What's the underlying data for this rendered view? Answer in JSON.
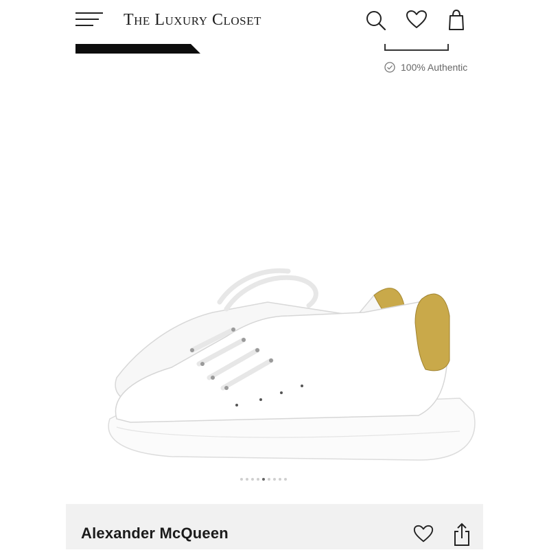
{
  "header": {
    "logo": "The Luxury Closet",
    "icons": [
      "menu-icon",
      "search-icon",
      "heart-icon",
      "shopping-bag-icon"
    ]
  },
  "authentic_badge": {
    "label": "100% Authentic",
    "icon": "check-circle-icon"
  },
  "gallery": {
    "image_subject": "shoe-image",
    "dot_count": 9,
    "active_dot_index": 4
  },
  "product": {
    "brand": "Alexander McQueen",
    "icons": [
      "heart-icon",
      "share-icon"
    ]
  },
  "colors": {
    "accent": "#111111",
    "panel_bg": "#f1f1f1",
    "gold": "#c9a94a"
  }
}
